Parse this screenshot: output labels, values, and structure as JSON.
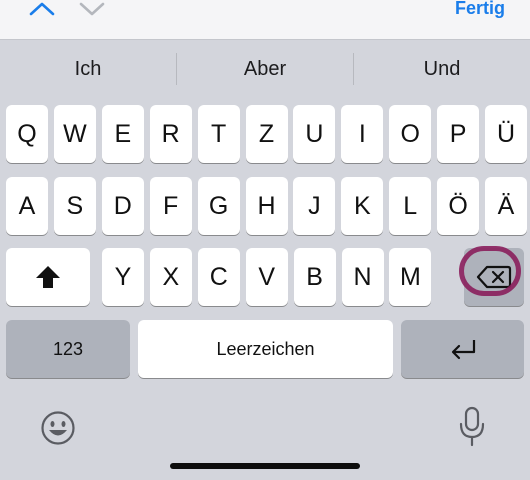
{
  "toolbar": {
    "up_icon": "chevron-up-icon",
    "down_icon": "chevron-down-icon",
    "done_label": "Fertig",
    "accent_color": "#1a7dea"
  },
  "suggestions": [
    "Ich",
    "Aber",
    "Und"
  ],
  "keyboard": {
    "row1": [
      "Q",
      "W",
      "E",
      "R",
      "T",
      "Z",
      "U",
      "I",
      "O",
      "P",
      "Ü"
    ],
    "row2": [
      "A",
      "S",
      "D",
      "F",
      "G",
      "H",
      "J",
      "K",
      "L",
      "Ö",
      "Ä"
    ],
    "row3": [
      "Y",
      "X",
      "C",
      "V",
      "B",
      "N",
      "M"
    ],
    "shift_icon": "shift-arrow-icon",
    "delete_icon": "backspace-icon",
    "numbers_label": "123",
    "space_label": "Leerzeichen",
    "return_icon": "return-arrow-icon",
    "emoji_icon": "emoji-face-icon",
    "mic_icon": "microphone-icon"
  },
  "annotation": {
    "highlight_color": "#8a1e5c"
  }
}
